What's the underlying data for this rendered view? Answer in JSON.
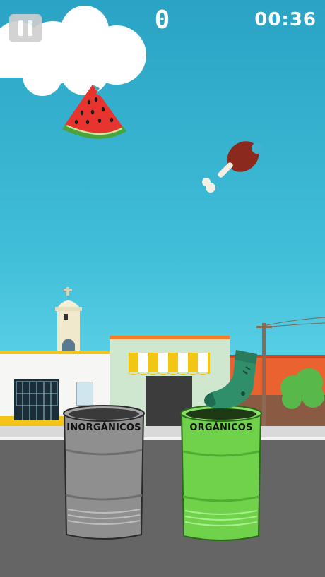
{
  "hud": {
    "score": "0",
    "timer": "00:36"
  },
  "bins": {
    "left": {
      "label": "INORGÁNICOS",
      "color": "#8f8f8f"
    },
    "right": {
      "label": "ORGÁNICOS",
      "color": "#6fd24a"
    }
  },
  "colors": {
    "sky_top": "#2aa3c4",
    "sky_bottom": "#7fe0ee",
    "road": "#666666",
    "awning": "#f2c714"
  },
  "icons": [
    "pause-icon",
    "cloud",
    "watermelon-slice",
    "chicken-leg",
    "green-sock",
    "church-tower",
    "shop-awning",
    "tree",
    "utility-pole"
  ]
}
